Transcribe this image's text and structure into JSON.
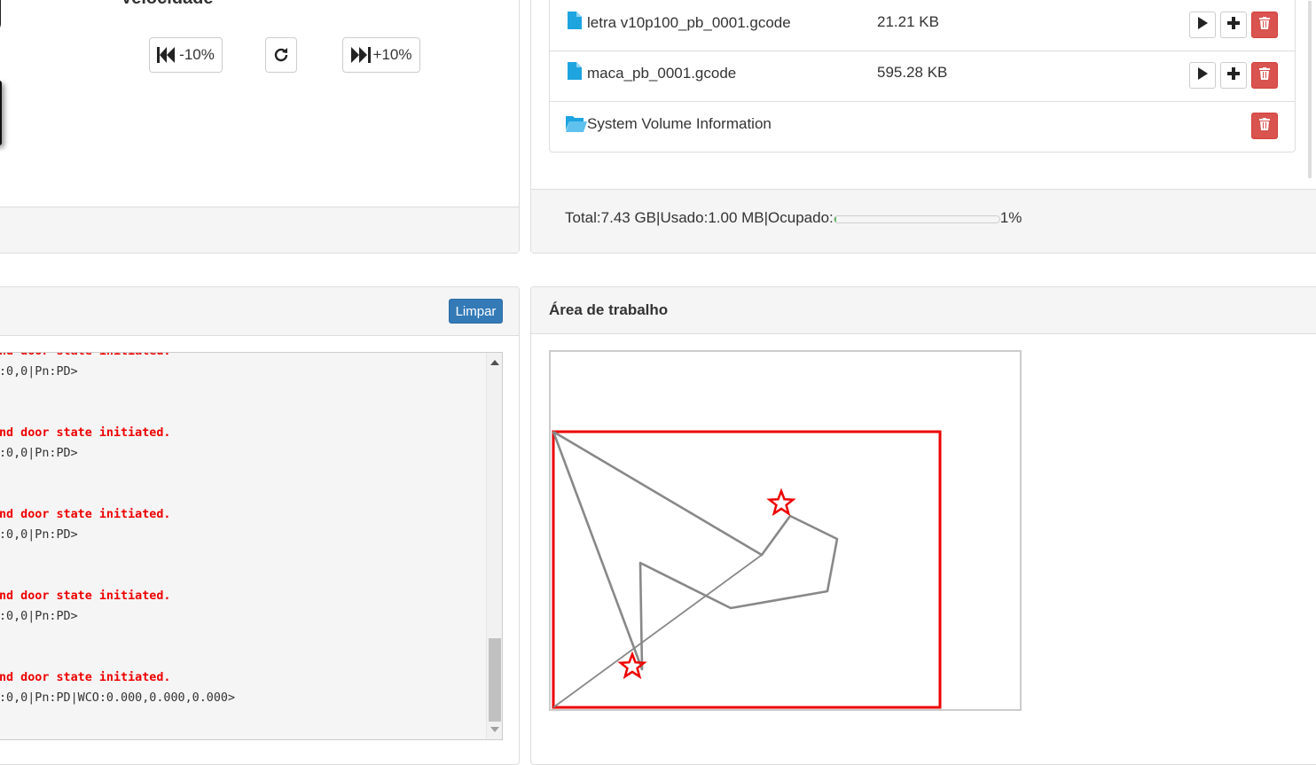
{
  "speed": {
    "title": "Velocidade",
    "decrease_label": "-10%",
    "increase_label": "+10%"
  },
  "files": {
    "rows": [
      {
        "name": "letra v10p100_pb_0001.gcode",
        "size": "21.21 KB",
        "type": "file"
      },
      {
        "name": "maca_pb_0001.gcode",
        "size": "595.28 KB",
        "type": "file"
      },
      {
        "name": "System Volume Information",
        "size": "",
        "type": "folder"
      }
    ],
    "storage": {
      "total_label": "Total:",
      "total": "7.43 GB",
      "separator": "|",
      "used_label": "Usado:",
      "used": "1.00 MB",
      "occupied_label": "Ocupado:",
      "occupied_percent": 1,
      "occupied_text": "1%"
    }
  },
  "console": {
    "clear_label": "Limpar",
    "lines": [
      {
        "text": "nd door state initiated.",
        "kind": "alarm"
      },
      {
        "text": ":0,0|Pn:PD>",
        "kind": "status"
      },
      {
        "text": "",
        "kind": "blank"
      },
      {
        "text": "",
        "kind": "blank"
      },
      {
        "text": "nd door state initiated.",
        "kind": "alarm"
      },
      {
        "text": ":0,0|Pn:PD>",
        "kind": "status"
      },
      {
        "text": "",
        "kind": "blank"
      },
      {
        "text": "",
        "kind": "blank"
      },
      {
        "text": "nd door state initiated.",
        "kind": "alarm"
      },
      {
        "text": ":0,0|Pn:PD>",
        "kind": "status"
      },
      {
        "text": "",
        "kind": "blank"
      },
      {
        "text": "",
        "kind": "blank"
      },
      {
        "text": "nd door state initiated.",
        "kind": "alarm"
      },
      {
        "text": ":0,0|Pn:PD>",
        "kind": "status"
      },
      {
        "text": "",
        "kind": "blank"
      },
      {
        "text": "",
        "kind": "blank"
      },
      {
        "text": "nd door state initiated.",
        "kind": "alarm"
      },
      {
        "text": ":0,0|Pn:PD|WCO:0.000,0.000,0.000>",
        "kind": "status"
      }
    ]
  },
  "workspace": {
    "title": "Área de trabalho"
  },
  "colors": {
    "primary": "#337ab7",
    "danger": "#d9534f",
    "alarm_text": "#ee0000",
    "work_area_border": "#ee0000",
    "toolpath": "#888888",
    "file_icon": "#1ea5e0"
  },
  "icons": {
    "decrease": "fast-backward-icon",
    "reset": "refresh-icon",
    "increase": "fast-forward-icon",
    "file": "file-icon",
    "folder": "folder-open-icon",
    "play": "play-icon",
    "add": "plus-icon",
    "delete": "trash-icon",
    "marker": "star-icon"
  }
}
